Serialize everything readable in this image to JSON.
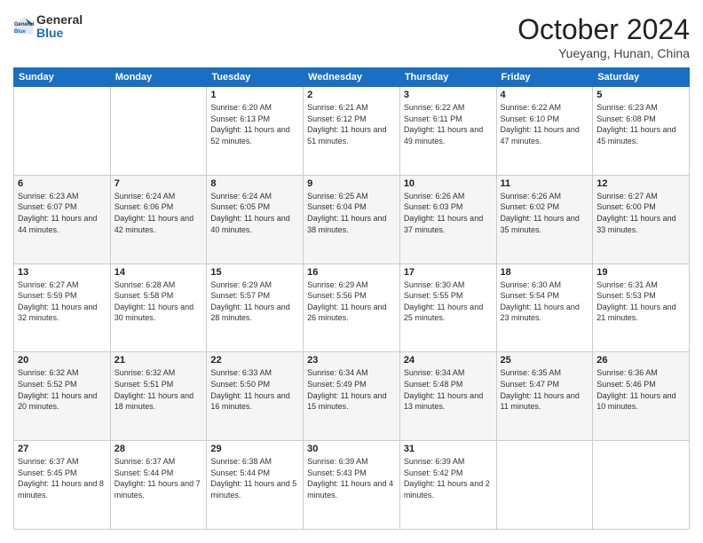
{
  "header": {
    "logo_general": "General",
    "logo_blue": "Blue",
    "title": "October 2024",
    "location": "Yueyang, Hunan, China"
  },
  "days_of_week": [
    "Sunday",
    "Monday",
    "Tuesday",
    "Wednesday",
    "Thursday",
    "Friday",
    "Saturday"
  ],
  "weeks": [
    [
      {
        "day": null,
        "sunrise": null,
        "sunset": null,
        "daylight": null
      },
      {
        "day": null,
        "sunrise": null,
        "sunset": null,
        "daylight": null
      },
      {
        "day": "1",
        "sunrise": "Sunrise: 6:20 AM",
        "sunset": "Sunset: 6:13 PM",
        "daylight": "Daylight: 11 hours and 52 minutes."
      },
      {
        "day": "2",
        "sunrise": "Sunrise: 6:21 AM",
        "sunset": "Sunset: 6:12 PM",
        "daylight": "Daylight: 11 hours and 51 minutes."
      },
      {
        "day": "3",
        "sunrise": "Sunrise: 6:22 AM",
        "sunset": "Sunset: 6:11 PM",
        "daylight": "Daylight: 11 hours and 49 minutes."
      },
      {
        "day": "4",
        "sunrise": "Sunrise: 6:22 AM",
        "sunset": "Sunset: 6:10 PM",
        "daylight": "Daylight: 11 hours and 47 minutes."
      },
      {
        "day": "5",
        "sunrise": "Sunrise: 6:23 AM",
        "sunset": "Sunset: 6:08 PM",
        "daylight": "Daylight: 11 hours and 45 minutes."
      }
    ],
    [
      {
        "day": "6",
        "sunrise": "Sunrise: 6:23 AM",
        "sunset": "Sunset: 6:07 PM",
        "daylight": "Daylight: 11 hours and 44 minutes."
      },
      {
        "day": "7",
        "sunrise": "Sunrise: 6:24 AM",
        "sunset": "Sunset: 6:06 PM",
        "daylight": "Daylight: 11 hours and 42 minutes."
      },
      {
        "day": "8",
        "sunrise": "Sunrise: 6:24 AM",
        "sunset": "Sunset: 6:05 PM",
        "daylight": "Daylight: 11 hours and 40 minutes."
      },
      {
        "day": "9",
        "sunrise": "Sunrise: 6:25 AM",
        "sunset": "Sunset: 6:04 PM",
        "daylight": "Daylight: 11 hours and 38 minutes."
      },
      {
        "day": "10",
        "sunrise": "Sunrise: 6:26 AM",
        "sunset": "Sunset: 6:03 PM",
        "daylight": "Daylight: 11 hours and 37 minutes."
      },
      {
        "day": "11",
        "sunrise": "Sunrise: 6:26 AM",
        "sunset": "Sunset: 6:02 PM",
        "daylight": "Daylight: 11 hours and 35 minutes."
      },
      {
        "day": "12",
        "sunrise": "Sunrise: 6:27 AM",
        "sunset": "Sunset: 6:00 PM",
        "daylight": "Daylight: 11 hours and 33 minutes."
      }
    ],
    [
      {
        "day": "13",
        "sunrise": "Sunrise: 6:27 AM",
        "sunset": "Sunset: 5:59 PM",
        "daylight": "Daylight: 11 hours and 32 minutes."
      },
      {
        "day": "14",
        "sunrise": "Sunrise: 6:28 AM",
        "sunset": "Sunset: 5:58 PM",
        "daylight": "Daylight: 11 hours and 30 minutes."
      },
      {
        "day": "15",
        "sunrise": "Sunrise: 6:29 AM",
        "sunset": "Sunset: 5:57 PM",
        "daylight": "Daylight: 11 hours and 28 minutes."
      },
      {
        "day": "16",
        "sunrise": "Sunrise: 6:29 AM",
        "sunset": "Sunset: 5:56 PM",
        "daylight": "Daylight: 11 hours and 26 minutes."
      },
      {
        "day": "17",
        "sunrise": "Sunrise: 6:30 AM",
        "sunset": "Sunset: 5:55 PM",
        "daylight": "Daylight: 11 hours and 25 minutes."
      },
      {
        "day": "18",
        "sunrise": "Sunrise: 6:30 AM",
        "sunset": "Sunset: 5:54 PM",
        "daylight": "Daylight: 11 hours and 23 minutes."
      },
      {
        "day": "19",
        "sunrise": "Sunrise: 6:31 AM",
        "sunset": "Sunset: 5:53 PM",
        "daylight": "Daylight: 11 hours and 21 minutes."
      }
    ],
    [
      {
        "day": "20",
        "sunrise": "Sunrise: 6:32 AM",
        "sunset": "Sunset: 5:52 PM",
        "daylight": "Daylight: 11 hours and 20 minutes."
      },
      {
        "day": "21",
        "sunrise": "Sunrise: 6:32 AM",
        "sunset": "Sunset: 5:51 PM",
        "daylight": "Daylight: 11 hours and 18 minutes."
      },
      {
        "day": "22",
        "sunrise": "Sunrise: 6:33 AM",
        "sunset": "Sunset: 5:50 PM",
        "daylight": "Daylight: 11 hours and 16 minutes."
      },
      {
        "day": "23",
        "sunrise": "Sunrise: 6:34 AM",
        "sunset": "Sunset: 5:49 PM",
        "daylight": "Daylight: 11 hours and 15 minutes."
      },
      {
        "day": "24",
        "sunrise": "Sunrise: 6:34 AM",
        "sunset": "Sunset: 5:48 PM",
        "daylight": "Daylight: 11 hours and 13 minutes."
      },
      {
        "day": "25",
        "sunrise": "Sunrise: 6:35 AM",
        "sunset": "Sunset: 5:47 PM",
        "daylight": "Daylight: 11 hours and 11 minutes."
      },
      {
        "day": "26",
        "sunrise": "Sunrise: 6:36 AM",
        "sunset": "Sunset: 5:46 PM",
        "daylight": "Daylight: 11 hours and 10 minutes."
      }
    ],
    [
      {
        "day": "27",
        "sunrise": "Sunrise: 6:37 AM",
        "sunset": "Sunset: 5:45 PM",
        "daylight": "Daylight: 11 hours and 8 minutes."
      },
      {
        "day": "28",
        "sunrise": "Sunrise: 6:37 AM",
        "sunset": "Sunset: 5:44 PM",
        "daylight": "Daylight: 11 hours and 7 minutes."
      },
      {
        "day": "29",
        "sunrise": "Sunrise: 6:38 AM",
        "sunset": "Sunset: 5:44 PM",
        "daylight": "Daylight: 11 hours and 5 minutes."
      },
      {
        "day": "30",
        "sunrise": "Sunrise: 6:39 AM",
        "sunset": "Sunset: 5:43 PM",
        "daylight": "Daylight: 11 hours and 4 minutes."
      },
      {
        "day": "31",
        "sunrise": "Sunrise: 6:39 AM",
        "sunset": "Sunset: 5:42 PM",
        "daylight": "Daylight: 11 hours and 2 minutes."
      },
      {
        "day": null,
        "sunrise": null,
        "sunset": null,
        "daylight": null
      },
      {
        "day": null,
        "sunrise": null,
        "sunset": null,
        "daylight": null
      }
    ]
  ]
}
